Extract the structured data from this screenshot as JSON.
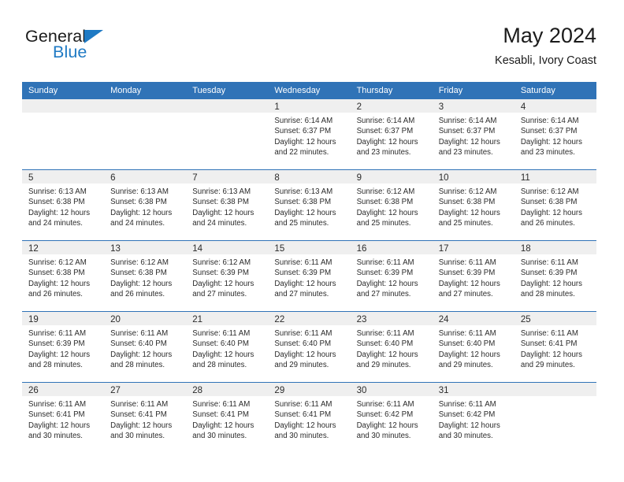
{
  "brand": {
    "word_one": "General",
    "word_two": "Blue",
    "flag_icon": "triangle-flag-icon",
    "accent_color": "#1f7ac4"
  },
  "header": {
    "title": "May 2024",
    "subtitle": "Kesabli, Ivory Coast"
  },
  "colors": {
    "header_blue": "#3073b7",
    "date_band_gray": "#efefef",
    "text": "#2b2b2b"
  },
  "weekdays": [
    "Sunday",
    "Monday",
    "Tuesday",
    "Wednesday",
    "Thursday",
    "Friday",
    "Saturday"
  ],
  "weeks": [
    [
      {
        "day": "",
        "lines": []
      },
      {
        "day": "",
        "lines": []
      },
      {
        "day": "",
        "lines": []
      },
      {
        "day": "1",
        "lines": [
          "Sunrise: 6:14 AM",
          "Sunset: 6:37 PM",
          "Daylight: 12 hours",
          "and 22 minutes."
        ]
      },
      {
        "day": "2",
        "lines": [
          "Sunrise: 6:14 AM",
          "Sunset: 6:37 PM",
          "Daylight: 12 hours",
          "and 23 minutes."
        ]
      },
      {
        "day": "3",
        "lines": [
          "Sunrise: 6:14 AM",
          "Sunset: 6:37 PM",
          "Daylight: 12 hours",
          "and 23 minutes."
        ]
      },
      {
        "day": "4",
        "lines": [
          "Sunrise: 6:14 AM",
          "Sunset: 6:37 PM",
          "Daylight: 12 hours",
          "and 23 minutes."
        ]
      }
    ],
    [
      {
        "day": "5",
        "lines": [
          "Sunrise: 6:13 AM",
          "Sunset: 6:38 PM",
          "Daylight: 12 hours",
          "and 24 minutes."
        ]
      },
      {
        "day": "6",
        "lines": [
          "Sunrise: 6:13 AM",
          "Sunset: 6:38 PM",
          "Daylight: 12 hours",
          "and 24 minutes."
        ]
      },
      {
        "day": "7",
        "lines": [
          "Sunrise: 6:13 AM",
          "Sunset: 6:38 PM",
          "Daylight: 12 hours",
          "and 24 minutes."
        ]
      },
      {
        "day": "8",
        "lines": [
          "Sunrise: 6:13 AM",
          "Sunset: 6:38 PM",
          "Daylight: 12 hours",
          "and 25 minutes."
        ]
      },
      {
        "day": "9",
        "lines": [
          "Sunrise: 6:12 AM",
          "Sunset: 6:38 PM",
          "Daylight: 12 hours",
          "and 25 minutes."
        ]
      },
      {
        "day": "10",
        "lines": [
          "Sunrise: 6:12 AM",
          "Sunset: 6:38 PM",
          "Daylight: 12 hours",
          "and 25 minutes."
        ]
      },
      {
        "day": "11",
        "lines": [
          "Sunrise: 6:12 AM",
          "Sunset: 6:38 PM",
          "Daylight: 12 hours",
          "and 26 minutes."
        ]
      }
    ],
    [
      {
        "day": "12",
        "lines": [
          "Sunrise: 6:12 AM",
          "Sunset: 6:38 PM",
          "Daylight: 12 hours",
          "and 26 minutes."
        ]
      },
      {
        "day": "13",
        "lines": [
          "Sunrise: 6:12 AM",
          "Sunset: 6:38 PM",
          "Daylight: 12 hours",
          "and 26 minutes."
        ]
      },
      {
        "day": "14",
        "lines": [
          "Sunrise: 6:12 AM",
          "Sunset: 6:39 PM",
          "Daylight: 12 hours",
          "and 27 minutes."
        ]
      },
      {
        "day": "15",
        "lines": [
          "Sunrise: 6:11 AM",
          "Sunset: 6:39 PM",
          "Daylight: 12 hours",
          "and 27 minutes."
        ]
      },
      {
        "day": "16",
        "lines": [
          "Sunrise: 6:11 AM",
          "Sunset: 6:39 PM",
          "Daylight: 12 hours",
          "and 27 minutes."
        ]
      },
      {
        "day": "17",
        "lines": [
          "Sunrise: 6:11 AM",
          "Sunset: 6:39 PM",
          "Daylight: 12 hours",
          "and 27 minutes."
        ]
      },
      {
        "day": "18",
        "lines": [
          "Sunrise: 6:11 AM",
          "Sunset: 6:39 PM",
          "Daylight: 12 hours",
          "and 28 minutes."
        ]
      }
    ],
    [
      {
        "day": "19",
        "lines": [
          "Sunrise: 6:11 AM",
          "Sunset: 6:39 PM",
          "Daylight: 12 hours",
          "and 28 minutes."
        ]
      },
      {
        "day": "20",
        "lines": [
          "Sunrise: 6:11 AM",
          "Sunset: 6:40 PM",
          "Daylight: 12 hours",
          "and 28 minutes."
        ]
      },
      {
        "day": "21",
        "lines": [
          "Sunrise: 6:11 AM",
          "Sunset: 6:40 PM",
          "Daylight: 12 hours",
          "and 28 minutes."
        ]
      },
      {
        "day": "22",
        "lines": [
          "Sunrise: 6:11 AM",
          "Sunset: 6:40 PM",
          "Daylight: 12 hours",
          "and 29 minutes."
        ]
      },
      {
        "day": "23",
        "lines": [
          "Sunrise: 6:11 AM",
          "Sunset: 6:40 PM",
          "Daylight: 12 hours",
          "and 29 minutes."
        ]
      },
      {
        "day": "24",
        "lines": [
          "Sunrise: 6:11 AM",
          "Sunset: 6:40 PM",
          "Daylight: 12 hours",
          "and 29 minutes."
        ]
      },
      {
        "day": "25",
        "lines": [
          "Sunrise: 6:11 AM",
          "Sunset: 6:41 PM",
          "Daylight: 12 hours",
          "and 29 minutes."
        ]
      }
    ],
    [
      {
        "day": "26",
        "lines": [
          "Sunrise: 6:11 AM",
          "Sunset: 6:41 PM",
          "Daylight: 12 hours",
          "and 30 minutes."
        ]
      },
      {
        "day": "27",
        "lines": [
          "Sunrise: 6:11 AM",
          "Sunset: 6:41 PM",
          "Daylight: 12 hours",
          "and 30 minutes."
        ]
      },
      {
        "day": "28",
        "lines": [
          "Sunrise: 6:11 AM",
          "Sunset: 6:41 PM",
          "Daylight: 12 hours",
          "and 30 minutes."
        ]
      },
      {
        "day": "29",
        "lines": [
          "Sunrise: 6:11 AM",
          "Sunset: 6:41 PM",
          "Daylight: 12 hours",
          "and 30 minutes."
        ]
      },
      {
        "day": "30",
        "lines": [
          "Sunrise: 6:11 AM",
          "Sunset: 6:42 PM",
          "Daylight: 12 hours",
          "and 30 minutes."
        ]
      },
      {
        "day": "31",
        "lines": [
          "Sunrise: 6:11 AM",
          "Sunset: 6:42 PM",
          "Daylight: 12 hours",
          "and 30 minutes."
        ]
      },
      {
        "day": "",
        "lines": []
      }
    ]
  ]
}
